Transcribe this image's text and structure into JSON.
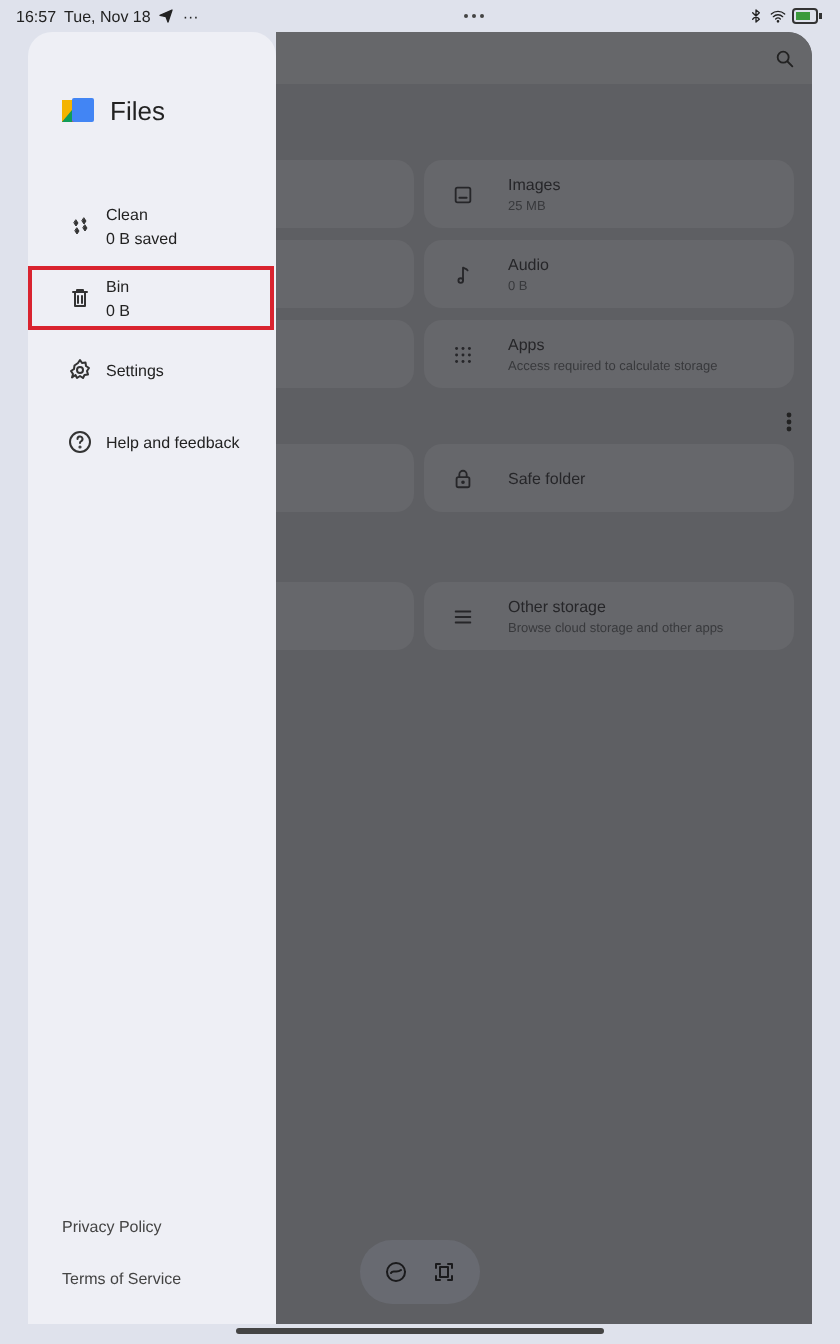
{
  "status_bar": {
    "time": "16:57",
    "date": "Tue, Nov 18",
    "overflow": "···"
  },
  "drawer": {
    "title": "Files",
    "items": [
      {
        "kind": "clean",
        "label": "Clean",
        "detail": "0 B saved",
        "highlighted": false
      },
      {
        "kind": "bin",
        "label": "Bin",
        "detail": "0 B",
        "highlighted": true
      },
      {
        "kind": "settings",
        "label": "Settings",
        "highlighted": false
      },
      {
        "kind": "help",
        "label": "Help and feedback",
        "highlighted": false
      }
    ],
    "footer_links": [
      "Privacy Policy",
      "Terms of Service"
    ]
  },
  "main": {
    "sections": [
      {
        "cards": [
          {
            "kind": "images",
            "title": "Images",
            "subtitle": "25 MB"
          },
          {
            "kind": "audio",
            "title": "Audio",
            "subtitle": "0 B"
          },
          {
            "kind": "apps",
            "title": "Apps",
            "subtitle": "Access required to calculate storage"
          }
        ]
      },
      {
        "cards": [
          {
            "kind": "safe",
            "title": "Safe folder"
          }
        ]
      },
      {
        "cards": [
          {
            "kind": "other",
            "title": "Other storage",
            "subtitle": "Browse cloud storage and other apps"
          }
        ]
      }
    ]
  }
}
